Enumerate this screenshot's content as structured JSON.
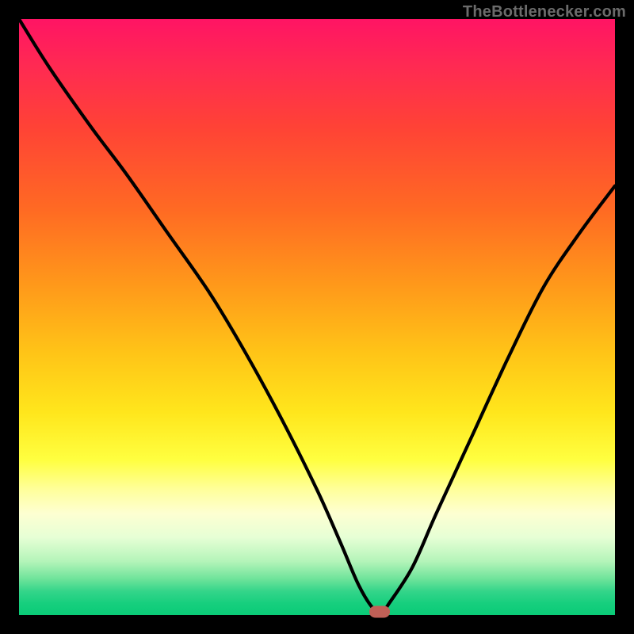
{
  "watermark": "TheBottlenecker.com",
  "chart_data": {
    "type": "line",
    "title": "",
    "xlabel": "",
    "ylabel": "",
    "xlim": [
      0,
      100
    ],
    "ylim": [
      0,
      100
    ],
    "series": [
      {
        "name": "bottleneck-curve",
        "x": [
          0,
          5,
          12,
          18,
          25,
          32,
          38,
          44,
          50,
          54,
          57,
          59.5,
          61,
          62,
          66,
          70,
          76,
          82,
          88,
          94,
          100
        ],
        "values": [
          100,
          92,
          82,
          74,
          64,
          54,
          44,
          33,
          21,
          12,
          5,
          1,
          0.5,
          1.8,
          8,
          17,
          30,
          43,
          55,
          64,
          72
        ]
      }
    ],
    "annotations": [
      {
        "name": "min-marker",
        "x": 60.5,
        "y": 0.5
      }
    ],
    "gradient_stops": [
      {
        "pos": 0,
        "color": "#ff1464"
      },
      {
        "pos": 8,
        "color": "#ff2a52"
      },
      {
        "pos": 18,
        "color": "#ff4236"
      },
      {
        "pos": 32,
        "color": "#ff6a23"
      },
      {
        "pos": 45,
        "color": "#ff9a1a"
      },
      {
        "pos": 56,
        "color": "#ffc417"
      },
      {
        "pos": 66,
        "color": "#ffe61c"
      },
      {
        "pos": 74,
        "color": "#ffff40"
      },
      {
        "pos": 79,
        "color": "#ffff9c"
      },
      {
        "pos": 83,
        "color": "#fdffd2"
      },
      {
        "pos": 87,
        "color": "#e6ffd5"
      },
      {
        "pos": 91,
        "color": "#b4f4b9"
      },
      {
        "pos": 94,
        "color": "#6de39a"
      },
      {
        "pos": 96,
        "color": "#34d58a"
      },
      {
        "pos": 98,
        "color": "#17cf7e"
      },
      {
        "pos": 100,
        "color": "#0acb77"
      }
    ]
  }
}
